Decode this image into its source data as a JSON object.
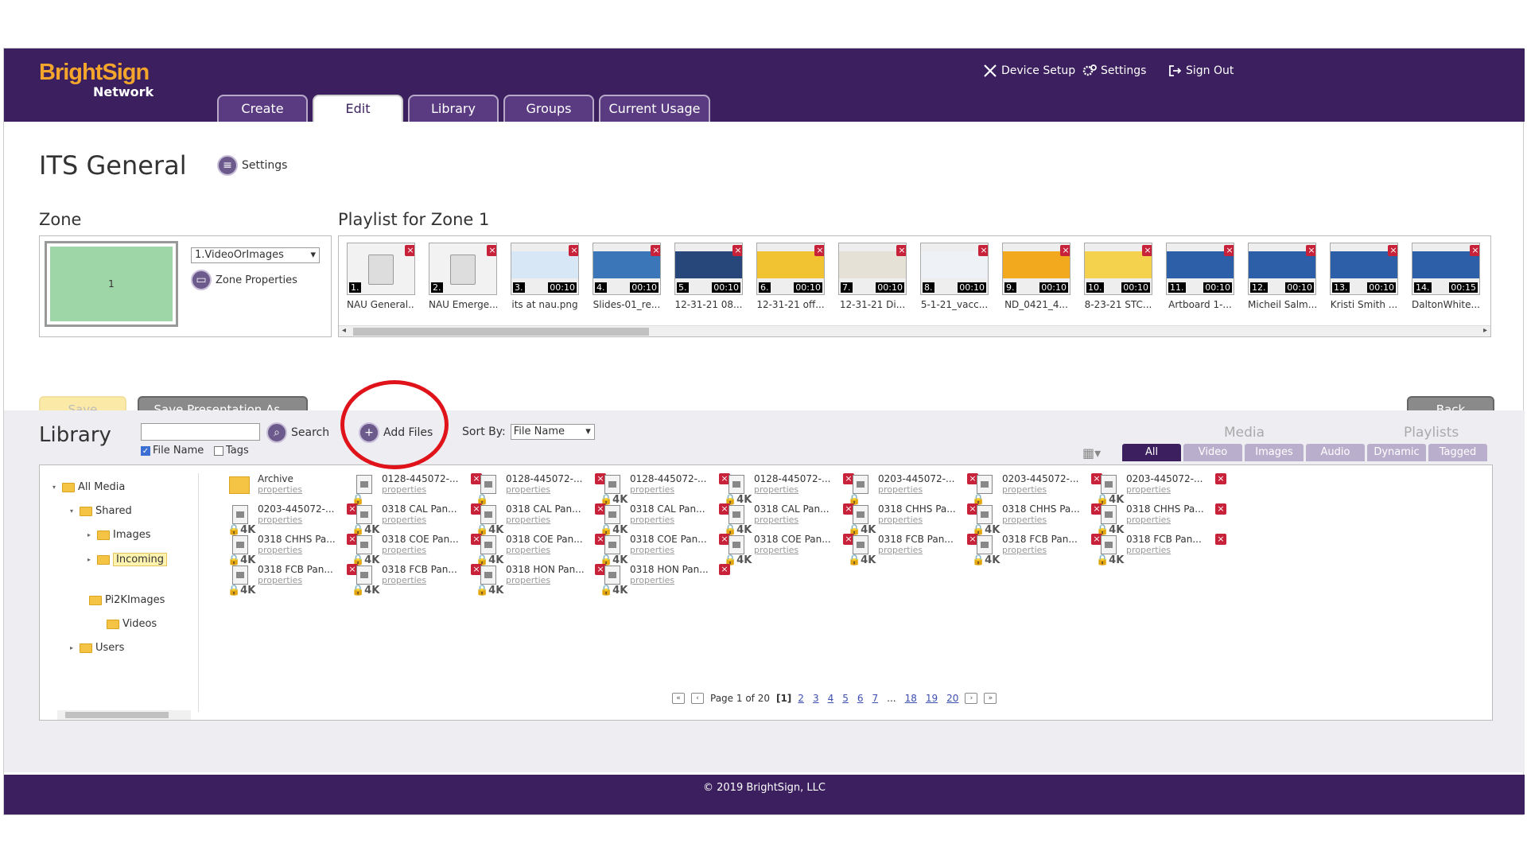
{
  "header": {
    "logo_top": "BrightSign",
    "logo_bottom": "Network",
    "device_setup": "Device Setup",
    "settings": "Settings",
    "sign_out": "Sign Out"
  },
  "tabs": [
    {
      "label": "Create"
    },
    {
      "label": "Edit"
    },
    {
      "label": "Library"
    },
    {
      "label": "Groups"
    },
    {
      "label": "Current Usage"
    }
  ],
  "presentation": {
    "title": "ITS General",
    "settings_label": "Settings"
  },
  "zone": {
    "heading": "Zone",
    "preview_number": "1",
    "selected": "1.VideoOrImages",
    "properties_label": "Zone Properties"
  },
  "playlist": {
    "heading": "Playlist for Zone 1",
    "items": [
      {
        "num": "1.",
        "dur": "",
        "cap": "NAU General...",
        "kind": "generic"
      },
      {
        "num": "2.",
        "dur": "",
        "cap": "NAU Emerge...",
        "kind": "generic"
      },
      {
        "num": "3.",
        "dur": "00:10",
        "cap": "its at nau.png",
        "kind": "img",
        "color": "#d7e7f5"
      },
      {
        "num": "4.",
        "dur": "00:10",
        "cap": "Slides-01_re...",
        "kind": "img",
        "color": "#3a76b8"
      },
      {
        "num": "5.",
        "dur": "00:10",
        "cap": "12-31-21 08...",
        "kind": "img",
        "color": "#27477a"
      },
      {
        "num": "6.",
        "dur": "00:10",
        "cap": "12-31-21 off...",
        "kind": "img",
        "color": "#f1c232"
      },
      {
        "num": "7.",
        "dur": "00:10",
        "cap": "12-31-21 Di...",
        "kind": "img",
        "color": "#e6e1d6"
      },
      {
        "num": "8.",
        "dur": "00:10",
        "cap": "5-1-21_vacc...",
        "kind": "img",
        "color": "#eef2f6"
      },
      {
        "num": "9.",
        "dur": "00:10",
        "cap": "ND_0421_4...",
        "kind": "img",
        "color": "#f2a91e"
      },
      {
        "num": "10.",
        "dur": "00:10",
        "cap": "8-23-21 STC...",
        "kind": "img",
        "color": "#f4d24e"
      },
      {
        "num": "11.",
        "dur": "00:10",
        "cap": "Artboard 1-...",
        "kind": "img",
        "color": "#2d5fa8"
      },
      {
        "num": "12.",
        "dur": "00:10",
        "cap": "Micheil Salm...",
        "kind": "img",
        "color": "#2d5fa8"
      },
      {
        "num": "13.",
        "dur": "00:10",
        "cap": "Kristi Smith ...",
        "kind": "img",
        "color": "#2d5fa8"
      },
      {
        "num": "14.",
        "dur": "00:15",
        "cap": "DaltonWhite...",
        "kind": "img",
        "color": "#2d5fa8"
      }
    ]
  },
  "buttons": {
    "save": "Save",
    "save_as": "Save Presentation As...",
    "back": "Back"
  },
  "library": {
    "heading": "Library",
    "search_label": "Search",
    "search_value": "",
    "file_name_label": "File Name",
    "tags_label": "Tags",
    "add_files": "Add Files",
    "sort_by_label": "Sort By:",
    "sort_by_value": "File Name",
    "media_label": "Media",
    "playlists_label": "Playlists",
    "filter_tabs": [
      {
        "label": "All"
      },
      {
        "label": "Video"
      },
      {
        "label": "Images"
      },
      {
        "label": "Audio"
      },
      {
        "label": "Dynamic"
      },
      {
        "label": "Tagged"
      }
    ],
    "tree": [
      {
        "label": "All Media"
      },
      {
        "label": "Shared"
      },
      {
        "label": "Images"
      },
      {
        "label": "Incoming"
      },
      {
        "label": "Pi2KImages"
      },
      {
        "label": "Videos"
      },
      {
        "label": "Users"
      }
    ],
    "items": [
      {
        "name": "Archive",
        "props": "properties",
        "kind": "folder"
      },
      {
        "name": "0128-445072-...",
        "props": "properties",
        "kind": "lock"
      },
      {
        "name": "0128-445072-...",
        "props": "properties",
        "kind": "lock"
      },
      {
        "name": "0128-445072-...",
        "props": "properties",
        "kind": "4k"
      },
      {
        "name": "0128-445072-...",
        "props": "properties",
        "kind": "4k"
      },
      {
        "name": "0203-445072-...",
        "props": "properties",
        "kind": "lock"
      },
      {
        "name": "0203-445072-...",
        "props": "properties",
        "kind": "lock"
      },
      {
        "name": "0203-445072-...",
        "props": "properties",
        "kind": "4k"
      },
      {
        "name": "0203-445072-...",
        "props": "properties",
        "kind": "4k"
      },
      {
        "name": "0318 CAL Pan...",
        "props": "properties",
        "kind": "4k"
      },
      {
        "name": "0318 CAL Pan...",
        "props": "properties",
        "kind": "4k"
      },
      {
        "name": "0318 CAL Pan...",
        "props": "properties",
        "kind": "4k"
      },
      {
        "name": "0318 CAL Pan...",
        "props": "properties",
        "kind": "4k"
      },
      {
        "name": "0318 CHHS Pa...",
        "props": "properties",
        "kind": "4k"
      },
      {
        "name": "0318 CHHS Pa...",
        "props": "properties",
        "kind": "4k"
      },
      {
        "name": "0318 CHHS Pa...",
        "props": "properties",
        "kind": "4k"
      },
      {
        "name": "0318 CHHS Pa...",
        "props": "properties",
        "kind": "4k"
      },
      {
        "name": "0318 COE Pan...",
        "props": "properties",
        "kind": "4k"
      },
      {
        "name": "0318 COE Pan...",
        "props": "properties",
        "kind": "4k"
      },
      {
        "name": "0318 COE Pan...",
        "props": "properties",
        "kind": "4k"
      },
      {
        "name": "0318 COE Pan...",
        "props": "properties",
        "kind": "4k"
      },
      {
        "name": "0318 FCB Pan...",
        "props": "properties",
        "kind": "4k"
      },
      {
        "name": "0318 FCB Pan...",
        "props": "properties",
        "kind": "4k"
      },
      {
        "name": "0318 FCB Pan...",
        "props": "properties",
        "kind": "4k"
      },
      {
        "name": "0318 FCB Pan...",
        "props": "properties",
        "kind": "4k"
      },
      {
        "name": "0318 FCB Pan...",
        "props": "properties",
        "kind": "4k"
      },
      {
        "name": "0318 HON Pan...",
        "props": "properties",
        "kind": "4k"
      },
      {
        "name": "0318 HON Pan...",
        "props": "properties",
        "kind": "4k"
      }
    ],
    "pager": {
      "prefix": "Page 1 of 20",
      "current": "[1]",
      "pages": [
        "2",
        "3",
        "4",
        "5",
        "6",
        "7",
        "...",
        "18",
        "19",
        "20"
      ]
    }
  },
  "footer": {
    "copyright": "© 2019 BrightSign, LLC"
  },
  "colors": {
    "header": "#3b1f5e",
    "accent": "#f4a52c",
    "annotation": "#e0131b"
  }
}
